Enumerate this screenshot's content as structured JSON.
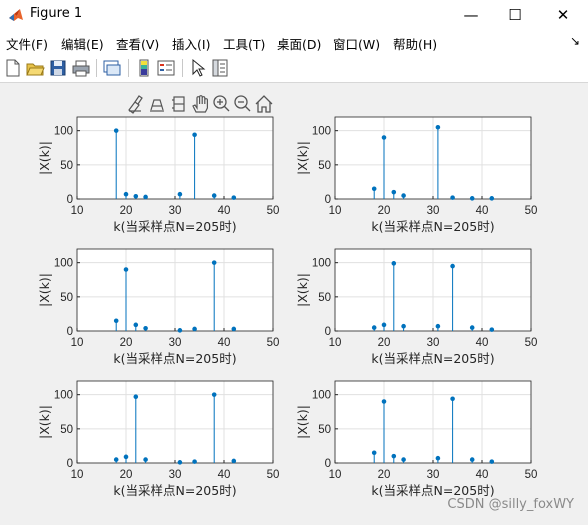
{
  "window": {
    "title": "Figure 1",
    "minimize_glyph": "—",
    "maximize_glyph": "☐",
    "close_glyph": "✕"
  },
  "menu": {
    "items": [
      "文件(F)",
      "编辑(E)",
      "查看(V)",
      "插入(I)",
      "工具(T)",
      "桌面(D)",
      "窗口(W)",
      "帮助(H)"
    ],
    "overflow_glyph": "↘"
  },
  "toolbar": {
    "icons": [
      "new-figure-icon",
      "open-file-icon",
      "save-icon",
      "print-icon",
      "link-plot-icon",
      "insert-colorbar-icon",
      "insert-legend-icon",
      "edit-plot-arrow-icon",
      "property-inspector-icon"
    ]
  },
  "axes_toolbar": {
    "icons": [
      "brush-icon",
      "data-cursor-icon",
      "rotate-icon",
      "pan-hand-icon",
      "zoom-in-icon",
      "zoom-out-icon",
      "home-icon"
    ]
  },
  "colors": {
    "stem": "#0072bd",
    "grid": "#e0e0e0",
    "axis": "#262626",
    "background": "#f0f0f0"
  },
  "chart_data": [
    {
      "type": "stem",
      "xlabel": "k(当采样点N=205时)",
      "ylabel": "|X(k)|",
      "xlim": [
        10,
        50
      ],
      "ylim": [
        0,
        120
      ],
      "xticks": [
        10,
        20,
        30,
        40,
        50
      ],
      "yticks": [
        0,
        50,
        100
      ],
      "grid": true,
      "x": [
        18,
        20,
        22,
        24,
        31,
        34,
        38,
        42
      ],
      "y": [
        100,
        7,
        4,
        3,
        7,
        94,
        5,
        2
      ]
    },
    {
      "type": "stem",
      "xlabel": "k(当采样点N=205时)",
      "ylabel": "|X(k)|",
      "xlim": [
        10,
        50
      ],
      "ylim": [
        0,
        120
      ],
      "xticks": [
        10,
        20,
        30,
        40,
        50
      ],
      "yticks": [
        0,
        50,
        100
      ],
      "grid": true,
      "x": [
        18,
        20,
        22,
        24,
        31,
        34,
        38,
        42
      ],
      "y": [
        15,
        90,
        10,
        5,
        105,
        2,
        1,
        1
      ]
    },
    {
      "type": "stem",
      "xlabel": "k(当采样点N=205时)",
      "ylabel": "|X(k)|",
      "xlim": [
        10,
        50
      ],
      "ylim": [
        0,
        120
      ],
      "xticks": [
        10,
        20,
        30,
        40,
        50
      ],
      "yticks": [
        0,
        50,
        100
      ],
      "grid": true,
      "x": [
        18,
        20,
        22,
        24,
        31,
        34,
        38,
        42
      ],
      "y": [
        15,
        90,
        9,
        4,
        1,
        3,
        100,
        3
      ]
    },
    {
      "type": "stem",
      "xlabel": "k(当采样点N=205时)",
      "ylabel": "|X(k)|",
      "xlim": [
        10,
        50
      ],
      "ylim": [
        0,
        120
      ],
      "xticks": [
        10,
        20,
        30,
        40,
        50
      ],
      "yticks": [
        0,
        50,
        100
      ],
      "grid": true,
      "x": [
        18,
        20,
        22,
        24,
        31,
        34,
        38,
        42
      ],
      "y": [
        5,
        9,
        99,
        7,
        7,
        95,
        5,
        2
      ]
    },
    {
      "type": "stem",
      "xlabel": "k(当采样点N=205时)",
      "ylabel": "|X(k)|",
      "xlim": [
        10,
        50
      ],
      "ylim": [
        0,
        120
      ],
      "xticks": [
        10,
        20,
        30,
        40,
        50
      ],
      "yticks": [
        0,
        50,
        100
      ],
      "grid": true,
      "x": [
        18,
        20,
        22,
        24,
        31,
        34,
        38,
        42
      ],
      "y": [
        5,
        9,
        97,
        5,
        1,
        2,
        100,
        3
      ]
    },
    {
      "type": "stem",
      "xlabel": "k(当采样点N=205时)",
      "ylabel": "|X(k)|",
      "xlim": [
        10,
        50
      ],
      "ylim": [
        0,
        120
      ],
      "xticks": [
        10,
        20,
        30,
        40,
        50
      ],
      "yticks": [
        0,
        50,
        100
      ],
      "grid": true,
      "x": [
        18,
        20,
        22,
        24,
        31,
        34,
        38,
        42
      ],
      "y": [
        15,
        90,
        10,
        5,
        7,
        94,
        5,
        2
      ]
    }
  ],
  "watermark": "CSDN @silly_foxWY"
}
